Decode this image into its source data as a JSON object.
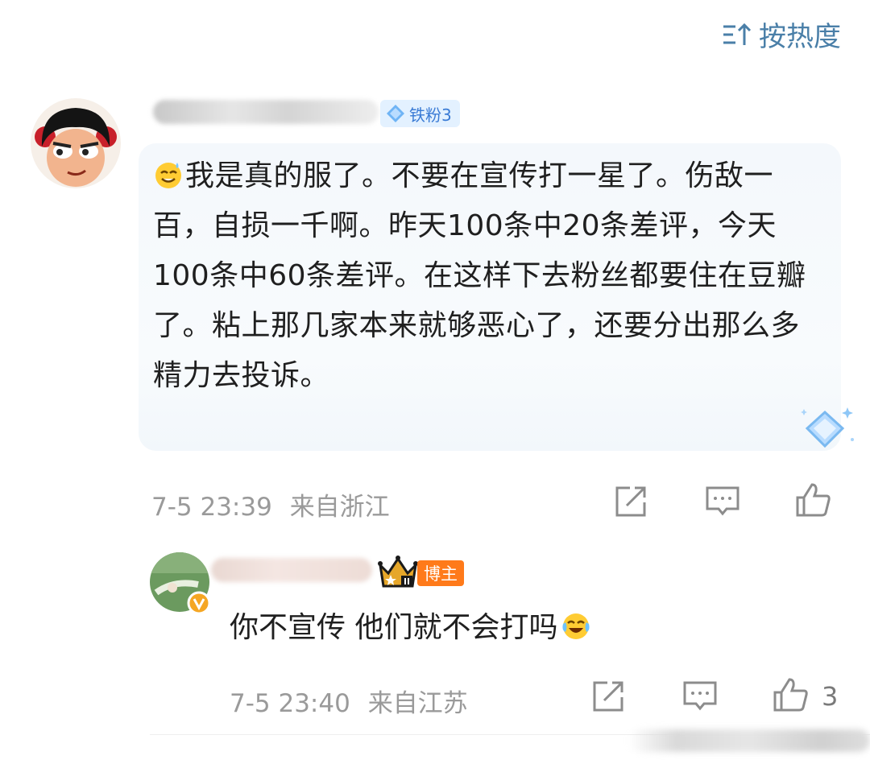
{
  "sort": {
    "label": "按热度",
    "icon": "sort-icon"
  },
  "comment": {
    "fan_badge": "铁粉3",
    "text": "我是真的服了。不要在宣传打一星了。伤敌一百，自损一千啊。昨天100条中20条差评，今天100条中60条差评。在这样下去粉丝都要住在豆瓣了。粘上那几家本来就够恶心了，还要分出那么多精力去投诉。",
    "lead_emoji": "sweat-smile-emoji",
    "time": "7-5 23:39",
    "location": "来自浙江",
    "actions": [
      "share-icon",
      "comment-icon",
      "like-icon"
    ]
  },
  "reply": {
    "role_badge": "博主",
    "text": "你不宣传 他们就不会打吗",
    "trail_emoji": "laugh-cry-emoji",
    "time": "7-5 23:40",
    "location": "来自江苏",
    "like_count": "3",
    "actions": [
      "share-icon",
      "comment-icon",
      "like-icon"
    ]
  },
  "colors": {
    "accent": "#4a7fa8",
    "fan_badge_bg": "#e3f1ff",
    "fan_badge_text": "#3a7bd5",
    "blogger_badge": "#ff7a1a",
    "meta_text": "#9a9a9a"
  }
}
